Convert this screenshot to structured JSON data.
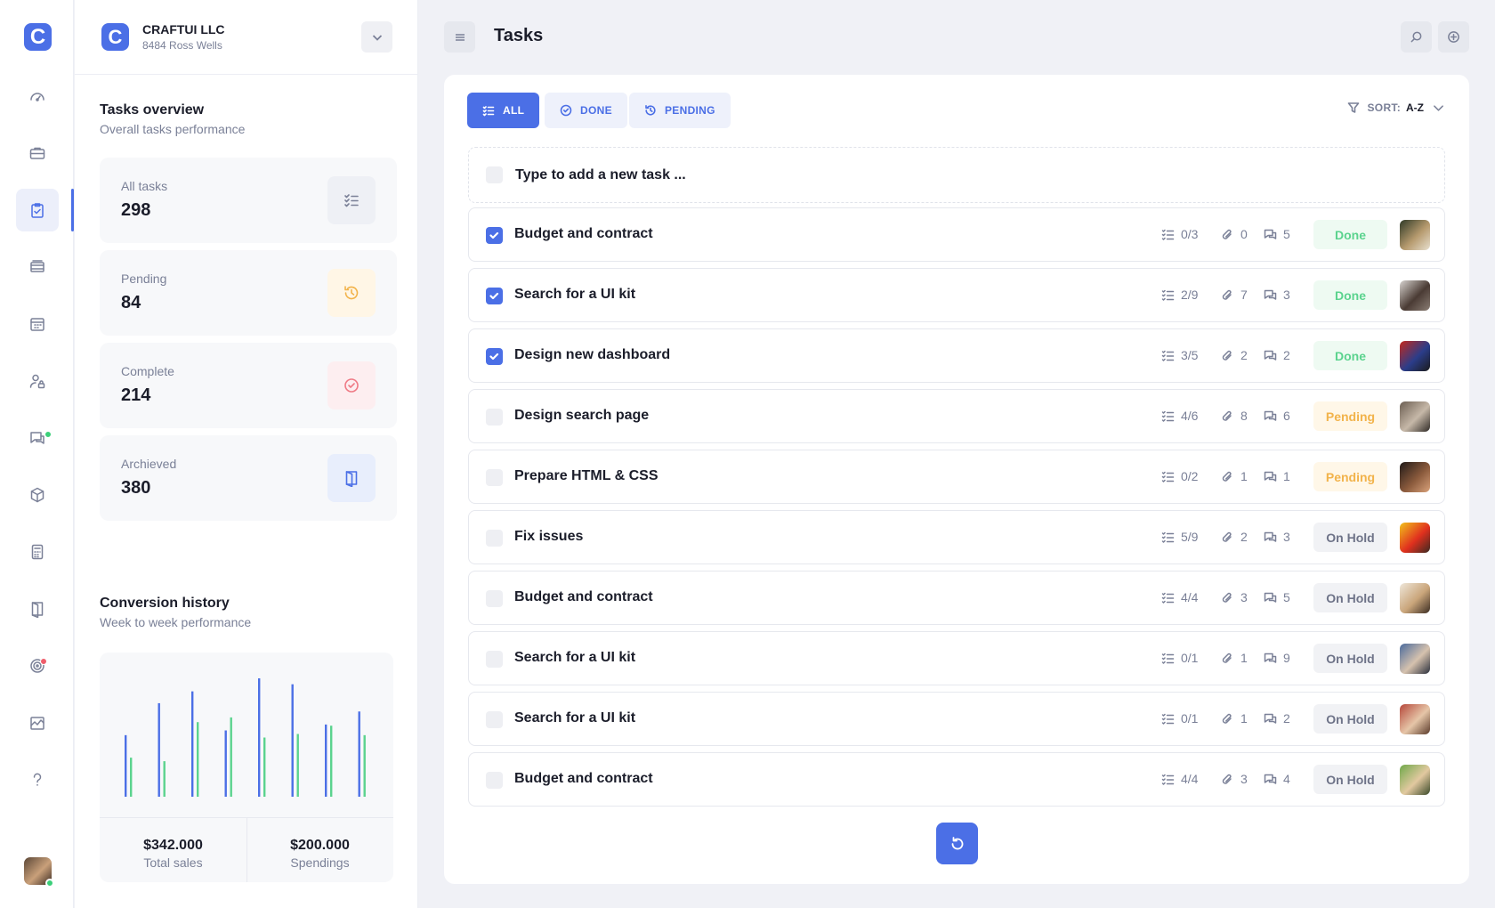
{
  "rail": {
    "logo": "C",
    "items": [
      {
        "icon": "speedometer-icon"
      },
      {
        "icon": "briefcase-icon"
      },
      {
        "icon": "clipboard-check-icon",
        "active": true
      },
      {
        "icon": "layers-icon"
      },
      {
        "icon": "calendar-icon"
      },
      {
        "icon": "user-lock-icon"
      },
      {
        "icon": "chat-icon",
        "badge": "#3ccf7a"
      },
      {
        "icon": "cube-icon"
      },
      {
        "icon": "calculator-icon"
      },
      {
        "icon": "door-icon"
      },
      {
        "icon": "target-icon",
        "badge": "#ef5d6b"
      },
      {
        "icon": "chart-area-icon"
      },
      {
        "icon": "help-icon"
      }
    ]
  },
  "company": {
    "logo": "C",
    "name": "CRAFTUI LLC",
    "address": "8484 Ross Wells"
  },
  "overview": {
    "title": "Tasks overview",
    "subtitle": "Overall tasks performance",
    "cards": [
      {
        "label": "All tasks",
        "value": "298",
        "icon": "list-check-icon",
        "color": "#7a8097",
        "bg": "#eef0f5"
      },
      {
        "label": "Pending",
        "value": "84",
        "icon": "history-icon",
        "color": "#f2b34b",
        "bg": "#fff6e6"
      },
      {
        "label": "Complete",
        "value": "214",
        "icon": "check-circle-icon",
        "color": "#ef7a85",
        "bg": "#fdeef0"
      },
      {
        "label": "Archieved",
        "value": "380",
        "icon": "door-icon",
        "color": "#4b6fe6",
        "bg": "#e8eefc"
      }
    ]
  },
  "conversion": {
    "title": "Conversion history",
    "subtitle": "Week to week performance",
    "total_sales_value": "$342.000",
    "total_sales_label": "Total sales",
    "spendings_value": "$200.000",
    "spendings_label": "Spendings"
  },
  "chart_data": {
    "type": "bar",
    "series": [
      {
        "color": "#4b6fe6",
        "values": [
          52,
          79,
          89,
          56,
          100,
          95,
          61,
          72
        ]
      },
      {
        "color": "#5bd38e",
        "values": [
          33,
          30,
          63,
          67,
          50,
          53,
          60,
          52
        ]
      }
    ],
    "ylim": [
      0,
      100
    ],
    "grid": false
  },
  "header": {
    "title": "Tasks"
  },
  "filters": {
    "all": "ALL",
    "done": "DONE",
    "pending": "PENDING"
  },
  "sort": {
    "label": "SORT:",
    "value": "A-Z"
  },
  "new_task": {
    "placeholder": "Type to add a new task ..."
  },
  "tasks": [
    {
      "title": "Budget and contract",
      "checked": true,
      "subtasks": "0/3",
      "attachments": "0",
      "comments": "5",
      "status": "Done",
      "status_kind": "done",
      "avatar_colors": [
        "#2f3a27",
        "#b69a6e",
        "#e8e0cf"
      ]
    },
    {
      "title": "Search for a UI kit",
      "checked": true,
      "subtasks": "2/9",
      "attachments": "7",
      "comments": "3",
      "status": "Done",
      "status_kind": "done",
      "avatar_colors": [
        "#d7d3cf",
        "#4a3b34",
        "#8a7d74"
      ]
    },
    {
      "title": "Design new dashboard",
      "checked": true,
      "subtasks": "3/5",
      "attachments": "2",
      "comments": "2",
      "status": "Done",
      "status_kind": "done",
      "avatar_colors": [
        "#c4281c",
        "#2b3d8a",
        "#1b1b1b"
      ]
    },
    {
      "title": "Design search page",
      "checked": false,
      "subtasks": "4/6",
      "attachments": "8",
      "comments": "6",
      "status": "Pending",
      "status_kind": "pending",
      "avatar_colors": [
        "#6b5e52",
        "#c6b8a8",
        "#2f2a26"
      ]
    },
    {
      "title": "Prepare HTML & CSS",
      "checked": false,
      "subtasks": "0/2",
      "attachments": "1",
      "comments": "1",
      "status": "Pending",
      "status_kind": "pending",
      "avatar_colors": [
        "#201a18",
        "#8a5a3c",
        "#d9a27a"
      ]
    },
    {
      "title": "Fix issues",
      "checked": false,
      "subtasks": "5/9",
      "attachments": "2",
      "comments": "3",
      "status": "On Hold",
      "status_kind": "hold",
      "avatar_colors": [
        "#f2c21b",
        "#e0301e",
        "#3a2a22"
      ]
    },
    {
      "title": "Budget and contract",
      "checked": false,
      "subtasks": "4/4",
      "attachments": "3",
      "comments": "5",
      "status": "On Hold",
      "status_kind": "hold",
      "avatar_colors": [
        "#efe7da",
        "#c9a57a",
        "#3b2c22"
      ]
    },
    {
      "title": "Search for a UI kit",
      "checked": false,
      "subtasks": "0/1",
      "attachments": "1",
      "comments": "9",
      "status": "On Hold",
      "status_kind": "hold",
      "avatar_colors": [
        "#4a6a9c",
        "#d6c2ae",
        "#2a2f3c"
      ]
    },
    {
      "title": "Search for a UI kit",
      "checked": false,
      "subtasks": "0/1",
      "attachments": "1",
      "comments": "2",
      "status": "On Hold",
      "status_kind": "hold",
      "avatar_colors": [
        "#b5473a",
        "#e6c6a8",
        "#5a3a2a"
      ]
    },
    {
      "title": "Budget and contract",
      "checked": false,
      "subtasks": "4/4",
      "attachments": "3",
      "comments": "4",
      "status": "On Hold",
      "status_kind": "hold",
      "avatar_colors": [
        "#6fa84a",
        "#e2c9a0",
        "#3b4a2a"
      ]
    }
  ],
  "colors": {
    "accent": "#4b6fe6",
    "done": "#5bd38e",
    "pending": "#f2b34b",
    "hold": "#6e7388"
  }
}
